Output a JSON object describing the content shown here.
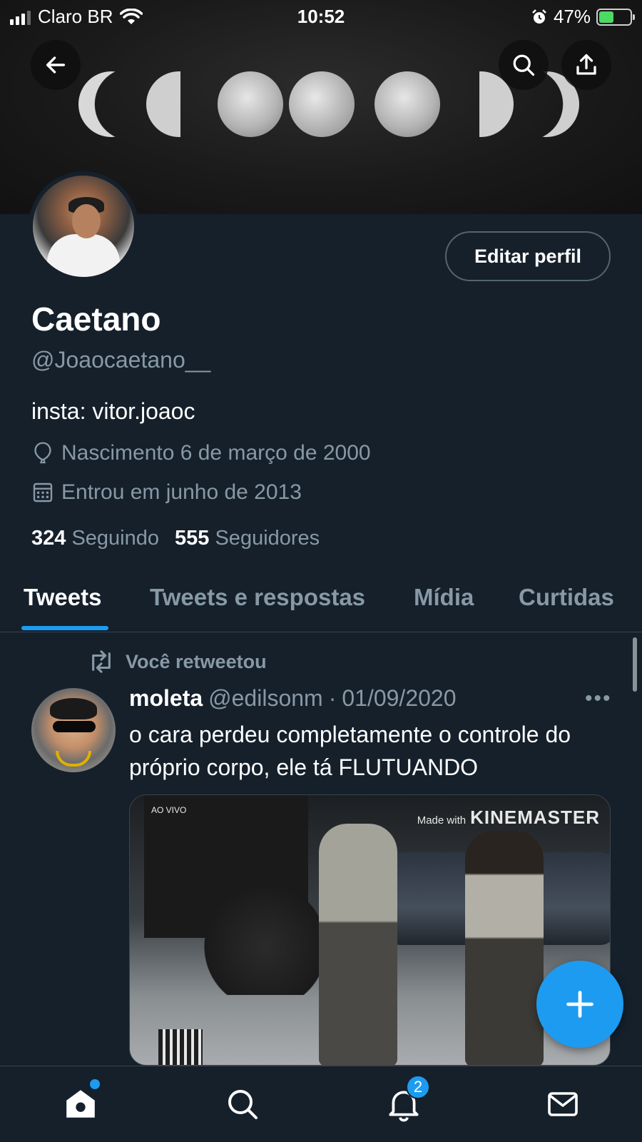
{
  "status_bar": {
    "carrier": "Claro BR",
    "time": "10:52",
    "battery": "47%",
    "battery_level": 0.47
  },
  "banner": {
    "back_icon": "arrow-left-icon",
    "search_icon": "search-icon",
    "share_icon": "share-icon"
  },
  "profile": {
    "edit_label": "Editar perfil",
    "name": "Caetano",
    "handle": "@Joaocaetano__",
    "bio": "insta: vitor.joaoc",
    "birth": "Nascimento 6 de março de 2000",
    "joined": "Entrou em junho de 2013",
    "following_count": "324",
    "following_label": "Seguindo",
    "followers_count": "555",
    "followers_label": "Seguidores"
  },
  "tabs": [
    {
      "label": "Tweets",
      "active": true
    },
    {
      "label": "Tweets e respostas",
      "active": false
    },
    {
      "label": "Mídia",
      "active": false
    },
    {
      "label": "Curtidas",
      "active": false
    }
  ],
  "tweet": {
    "retweet_label": "Você retweetou",
    "author": "moleta",
    "handle": "@edilsonm",
    "separator": "·",
    "date": "01/09/2020",
    "text": "o cara perdeu completamente o controle do próprio corpo, ele tá FLUTUANDO",
    "media_watermark_small": "Made with",
    "media_watermark_brand": "KINEMASTER",
    "media_live": "AO VIVO"
  },
  "bottom_nav": {
    "notifications_badge": "2"
  },
  "colors": {
    "background": "#15202b",
    "accent": "#1d9bf0",
    "secondary_text": "#8899a6",
    "border": "#38444d"
  }
}
